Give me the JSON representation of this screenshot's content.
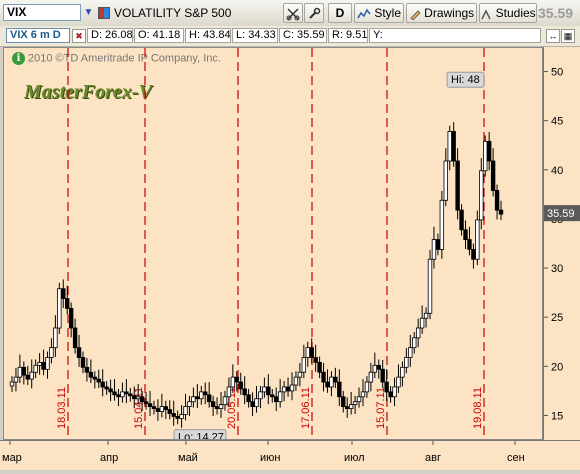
{
  "toolbar": {
    "symbol": "VIX",
    "description": "VOLATILITY S&P 500",
    "period_button": "D",
    "style_button": "Style",
    "drawings_button": "Drawings",
    "studies_button": "Studies",
    "last_price": "35.59"
  },
  "infobar": {
    "series_label": "VIX 6 m D",
    "date": "D: 26.08.11",
    "open": "O: 41.18",
    "high": "H: 43.84",
    "low": "L: 34.33",
    "close": "C: 35.59",
    "range": "R: 9.51",
    "y": "Y:"
  },
  "chart": {
    "copyright": "2010 ©TD Ameritrade IP Company, Inc.",
    "watermark": "MasterForex-V",
    "hi_label": "Hi: 48",
    "lo_label": "Lo: 14.27",
    "price_tag": "35.59",
    "colors": {
      "background": "#fbe3c4",
      "candle_up": "#ffffff",
      "candle_down": "#000000",
      "marker_line": "#cc0000",
      "grid": "#d8a070"
    }
  },
  "chart_data": {
    "type": "candlestick",
    "ylim": [
      12.5,
      52.5
    ],
    "y_ticks": [
      15,
      20,
      25,
      30,
      35,
      40,
      45,
      50
    ],
    "x_month_labels": [
      "мар",
      "апр",
      "май",
      "июн",
      "июл",
      "авг",
      "сен"
    ],
    "date_markers": [
      "18.03.11",
      "15.04.11",
      "20.05.11",
      "17.06.11",
      "15.07.11",
      "19.08.11"
    ],
    "extremes": {
      "high": 48,
      "low": 14.27
    },
    "last_close": 35.59,
    "approx_closes": [
      18.5,
      19,
      20,
      19.2,
      18.8,
      19.5,
      20.2,
      20.5,
      19.8,
      21,
      22,
      24,
      28,
      27,
      26,
      24,
      22,
      21,
      20,
      19.5,
      19,
      18.8,
      18.5,
      18,
      17.8,
      17.5,
      17.2,
      17,
      17.5,
      17.3,
      17.1,
      16.8,
      17,
      16.5,
      16.3,
      16,
      15.8,
      15.5,
      16,
      15.7,
      15.3,
      15,
      14.8,
      15.2,
      16,
      16.5,
      17,
      16.8,
      17.5,
      17.2,
      16.5,
      16,
      15.8,
      16.2,
      17,
      18,
      19,
      18.5,
      17.8,
      17.2,
      16.5,
      16,
      16.8,
      17.5,
      18,
      17.2,
      17,
      16.5,
      17.5,
      18,
      17.6,
      18.2,
      19,
      19.5,
      21,
      22,
      21,
      20.5,
      19.5,
      18.5,
      18,
      19,
      18.5,
      17,
      16,
      15.8,
      16.2,
      16.5,
      17,
      17.5,
      18.5,
      19.5,
      20.2,
      19.8,
      18.5,
      17.5,
      17,
      18,
      19,
      20,
      21,
      22,
      23,
      24,
      25,
      25.5,
      31,
      33,
      32,
      37,
      41,
      44,
      41,
      36,
      34,
      33,
      32,
      31,
      35,
      40,
      43,
      41,
      38,
      36,
      35.59
    ]
  }
}
